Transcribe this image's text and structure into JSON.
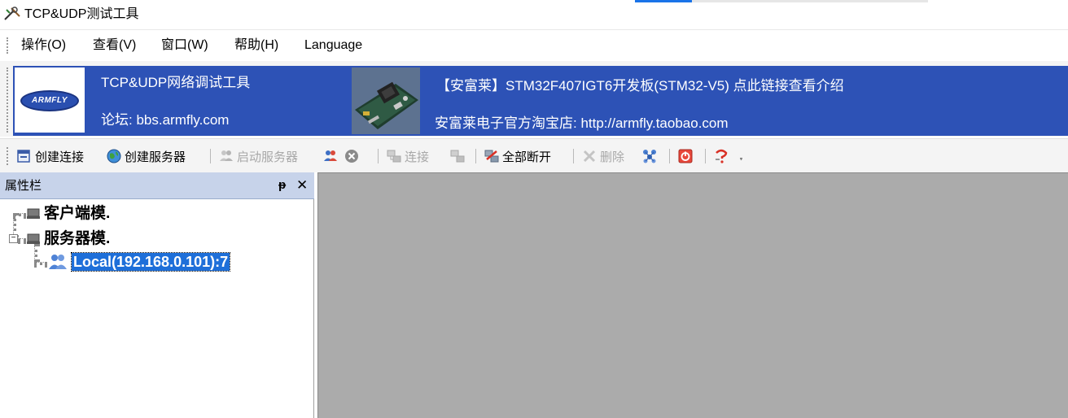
{
  "window": {
    "title": "TCP&UDP测试工具",
    "icon": "tools-icon"
  },
  "menu": {
    "items": [
      {
        "label": "操作(O)"
      },
      {
        "label": "查看(V)"
      },
      {
        "label": "窗口(W)"
      },
      {
        "label": "帮助(H)"
      },
      {
        "label": "Language"
      }
    ]
  },
  "banner": {
    "logo_text": "ARMFLY",
    "tool_name": "TCP&UDP网络调试工具",
    "forum": "论坛: bbs.armfly.com",
    "board_link": "【安富莱】STM32F407IGT6开发板(STM32-V5) 点此链接查看介绍",
    "shop": "安富莱电子官方淘宝店: http://armfly.taobao.com",
    "color": "#2d52b6"
  },
  "toolbar": {
    "create_connection": "创建连接",
    "create_server": "创建服务器",
    "start_server": "启动服务器",
    "connect": "连接",
    "disconnect_all": "全部断开",
    "delete": "删除"
  },
  "panel": {
    "title": "属性栏",
    "pin": "ᵽ",
    "close": "✕",
    "tree": {
      "client": "客户端模.",
      "server": "服务器模.",
      "local": "Local(192.168.0.101):7"
    }
  },
  "colors": {
    "selection": "#1e6fd9",
    "panel_header": "#c7d3ea",
    "workspace": "#ababab"
  }
}
